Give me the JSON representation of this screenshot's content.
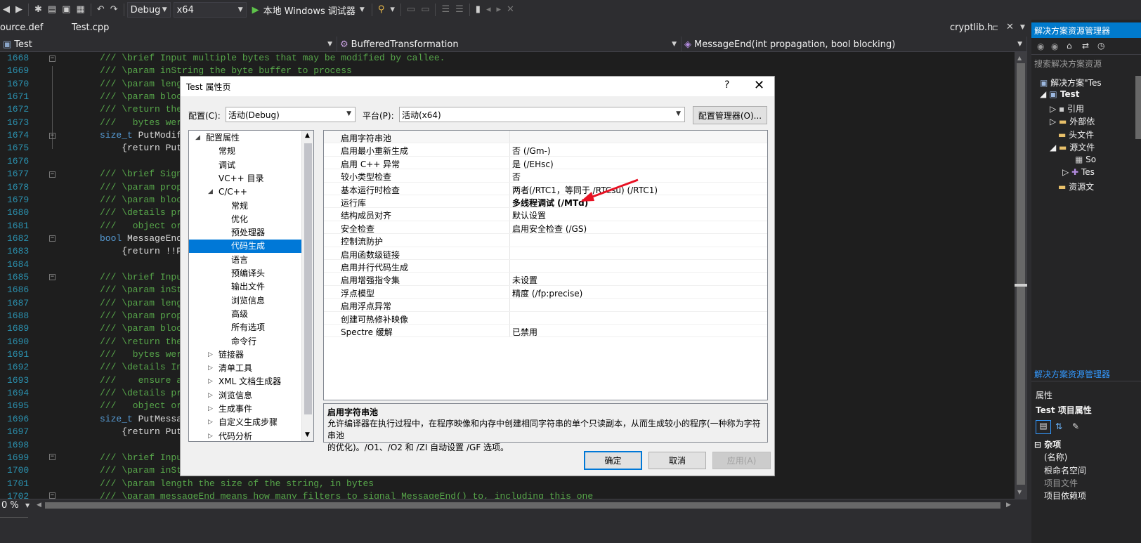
{
  "toolbar": {
    "config": "Debug",
    "platform": "x64",
    "run_label": "本地 Windows 调试器"
  },
  "editor_tabs": [
    "ource.def",
    "Test.cpp",
    "cryptlib.h"
  ],
  "navbar": {
    "scope": "Test",
    "class": "BufferedTransformation",
    "member": "MessageEnd(int propagation, bool blocking)"
  },
  "code_lines": [
    {
      "n": "1668",
      "t": "/// \\brief Input multiple bytes that may be modified by callee."
    },
    {
      "n": "1669",
      "t": "/// \\param inString the byte buffer to process"
    },
    {
      "n": "1670",
      "t": "/// \\param leng"
    },
    {
      "n": "1671",
      "t": "/// \\param bloc"
    },
    {
      "n": "1672",
      "t": "/// \\return the"
    },
    {
      "n": "1673",
      "t": "///   bytes were"
    },
    {
      "n": "1674",
      "t": "size_t PutModif"
    },
    {
      "n": "1675",
      "t": "    {return Put"
    },
    {
      "n": "1676",
      "t": ""
    },
    {
      "n": "1677",
      "t": "/// \\brief Sign"
    },
    {
      "n": "1678",
      "t": "/// \\param prop"
    },
    {
      "n": "1679",
      "t": "/// \\param bloc"
    },
    {
      "n": "1680",
      "t": "/// \\details pr"
    },
    {
      "n": "1681",
      "t": "///   object or"
    },
    {
      "n": "1682",
      "t": "bool MessageEnd"
    },
    {
      "n": "1683",
      "t": "    {return !!P"
    },
    {
      "n": "1684",
      "t": ""
    },
    {
      "n": "1685",
      "t": "/// \\brief Inpu"
    },
    {
      "n": "1686",
      "t": "/// \\param inSt"
    },
    {
      "n": "1687",
      "t": "/// \\param leng"
    },
    {
      "n": "1688",
      "t": "/// \\param prop"
    },
    {
      "n": "1689",
      "t": "/// \\param bloc"
    },
    {
      "n": "1690",
      "t": "/// \\return the"
    },
    {
      "n": "1691",
      "t": "///   bytes were"
    },
    {
      "n": "1692",
      "t": "/// \\details In"
    },
    {
      "n": "1693",
      "t": "///    ensure a"
    },
    {
      "n": "1694",
      "t": "/// \\details pr"
    },
    {
      "n": "1695",
      "t": "///   object or"
    },
    {
      "n": "1696",
      "t": "size_t PutMessa"
    },
    {
      "n": "1697",
      "t": "    {return Put"
    },
    {
      "n": "1698",
      "t": ""
    },
    {
      "n": "1699",
      "t": "/// \\brief Inpu"
    },
    {
      "n": "1700",
      "t": "/// \\param inSt"
    },
    {
      "n": "1701",
      "t": "/// \\param length the size of the string, in bytes"
    },
    {
      "n": "1702",
      "t": "/// \\param messageEnd means how many filters to signal MessageEnd() to, including this one"
    }
  ],
  "zoom": "0 %",
  "right_panel": {
    "solution_explorer_title": "解决方案资源管理器",
    "search_placeholder": "搜索解决方案资源",
    "solution": "解决方案\"Tes",
    "project": "Test",
    "nodes": [
      "引用",
      "外部依",
      "头文件",
      "源文件",
      "So",
      "Tes",
      "资源文"
    ],
    "solution_explorer_title2": "解决方案资源管理器",
    "properties_title": "属性",
    "properties_subject": "Test 项目属性",
    "category": "杂项",
    "props": [
      "(名称)",
      "根命名空间",
      "项目文件",
      "项目依赖项"
    ]
  },
  "dialog": {
    "title": "Test 属性页",
    "help": "?",
    "config_label": "配置(C):",
    "config_value": "活动(Debug)",
    "platform_label": "平台(P):",
    "platform_value": "活动(x64)",
    "config_manager": "配置管理器(O)...",
    "tree": [
      {
        "label": "配置属性",
        "level": 0,
        "exp": "open"
      },
      {
        "label": "常规",
        "level": 1
      },
      {
        "label": "调试",
        "level": 1
      },
      {
        "label": "VC++ 目录",
        "level": 1
      },
      {
        "label": "C/C++",
        "level": 1,
        "exp": "open"
      },
      {
        "label": "常规",
        "level": 2
      },
      {
        "label": "优化",
        "level": 2
      },
      {
        "label": "预处理器",
        "level": 2
      },
      {
        "label": "代码生成",
        "level": 2,
        "sel": true
      },
      {
        "label": "语言",
        "level": 2
      },
      {
        "label": "预编译头",
        "level": 2
      },
      {
        "label": "输出文件",
        "level": 2
      },
      {
        "label": "浏览信息",
        "level": 2
      },
      {
        "label": "高级",
        "level": 2
      },
      {
        "label": "所有选项",
        "level": 2
      },
      {
        "label": "命令行",
        "level": 2
      },
      {
        "label": "链接器",
        "level": 1,
        "exp": "closed"
      },
      {
        "label": "清单工具",
        "level": 1,
        "exp": "closed"
      },
      {
        "label": "XML 文档生成器",
        "level": 1,
        "exp": "closed"
      },
      {
        "label": "浏览信息",
        "level": 1,
        "exp": "closed"
      },
      {
        "label": "生成事件",
        "level": 1,
        "exp": "closed"
      },
      {
        "label": "自定义生成步骤",
        "level": 1,
        "exp": "closed"
      },
      {
        "label": "代码分析",
        "level": 1,
        "exp": "closed"
      }
    ],
    "grid": [
      {
        "name": "启用字符串池",
        "value": ""
      },
      {
        "name": "启用最小重新生成",
        "value": "否 (/Gm-)"
      },
      {
        "name": "启用 C++ 异常",
        "value": "是 (/EHsc)"
      },
      {
        "name": "较小类型检查",
        "value": "否"
      },
      {
        "name": "基本运行时检查",
        "value": "两者(/RTC1，等同于 /RTCsu) (/RTC1)"
      },
      {
        "name": "运行库",
        "value": "多线程调试 (/MTd)",
        "bold": true
      },
      {
        "name": "结构成员对齐",
        "value": "默认设置"
      },
      {
        "name": "安全检查",
        "value": "启用安全检查 (/GS)"
      },
      {
        "name": "控制流防护",
        "value": ""
      },
      {
        "name": "启用函数级链接",
        "value": ""
      },
      {
        "name": "启用并行代码生成",
        "value": ""
      },
      {
        "name": "启用增强指令集",
        "value": "未设置"
      },
      {
        "name": "浮点模型",
        "value": "精度 (/fp:precise)"
      },
      {
        "name": "启用浮点异常",
        "value": ""
      },
      {
        "name": "创建可热修补映像",
        "value": ""
      },
      {
        "name": "Spectre 缓解",
        "value": "已禁用"
      }
    ],
    "desc_title": "启用字符串池",
    "desc_line1": "允许编译器在执行过程中，在程序映像和内存中创建相同字符串的单个只读副本，从而生成较小的程序(一种称为字符串池",
    "desc_line2": "的优化)。/O1、/O2 和 /ZI 自动设置 /GF 选项。",
    "ok": "确定",
    "cancel": "取消",
    "apply": "应用(A)"
  },
  "colors": {
    "accent": "#007acc",
    "selection": "#0078d7",
    "annotation_arrow": "#e81123"
  }
}
